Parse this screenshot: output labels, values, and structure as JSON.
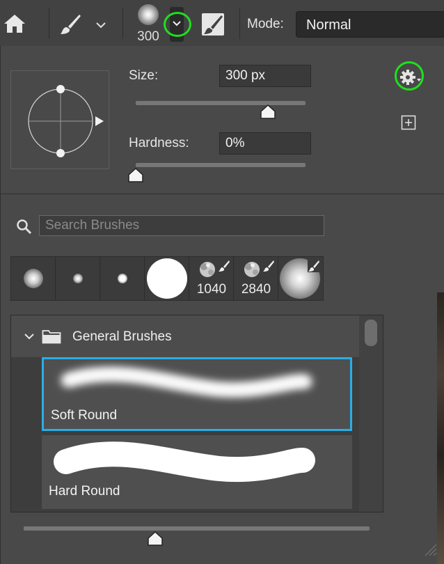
{
  "toolbar": {
    "brush_size": "300",
    "mode_label": "Mode:",
    "mode_value": "Normal"
  },
  "panel": {
    "size_label": "Size:",
    "size_value": "300 px",
    "size_slider_fraction": 0.78,
    "hardness_label": "Hardness:",
    "hardness_value": "0%",
    "hardness_slider_fraction": 0.0,
    "search_placeholder": "Search Brushes",
    "recent_brushes": [
      {
        "kind": "soft",
        "label": ""
      },
      {
        "kind": "small-soft",
        "label": ""
      },
      {
        "kind": "small-hard",
        "label": ""
      },
      {
        "kind": "hard-large",
        "label": ""
      },
      {
        "kind": "textured",
        "label": "1040"
      },
      {
        "kind": "textured",
        "label": "2840"
      },
      {
        "kind": "soft-large",
        "label": ""
      }
    ],
    "group_name": "General Brushes",
    "brushes": [
      {
        "name": "Soft Round",
        "selected": true
      },
      {
        "name": "Hard Round",
        "selected": false
      }
    ],
    "preview_slider_fraction": 0.38
  },
  "colors": {
    "highlight_ring": "#1ee01e",
    "selection_border": "#28aee6",
    "panel_bg": "#494949"
  },
  "icons": [
    "home-icon",
    "brush-icon",
    "chevron-down-icon",
    "brush-panel-toggle-icon",
    "gear-icon",
    "new-preset-icon",
    "search-icon",
    "folder-icon",
    "resize-grip-icon"
  ]
}
